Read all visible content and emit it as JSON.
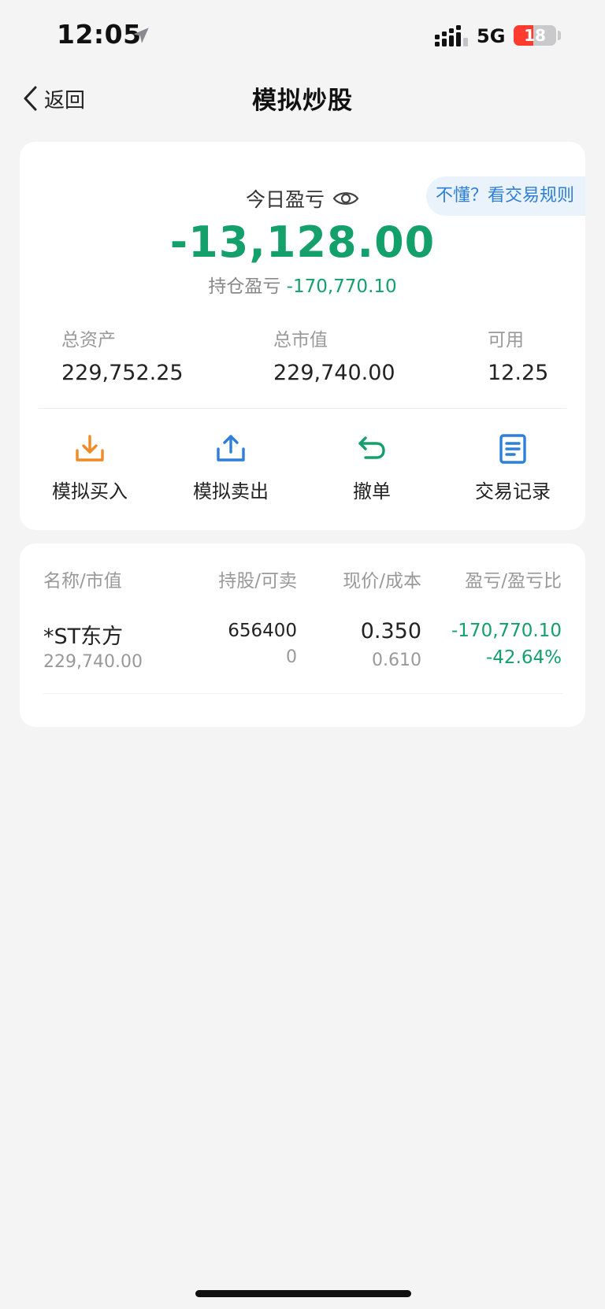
{
  "status_bar": {
    "time": "12:05",
    "network": "5G",
    "battery_level": 18,
    "battery_text": "18",
    "icons": [
      "location-arrow-icon",
      "signal-bars-icon",
      "battery-icon"
    ]
  },
  "nav": {
    "back_label": "返回",
    "title": "模拟炒股",
    "icons": [
      "chevron-left-icon"
    ]
  },
  "summary": {
    "rules_link": "不懂？看交易规则",
    "today_pnl_label": "今日盈亏",
    "today_pnl_value": "-13,128.00",
    "position_pnl_label": "持仓盈亏",
    "position_pnl_value": "-170,770.10",
    "stats": [
      {
        "label": "总资产",
        "value": "229,752.25"
      },
      {
        "label": "总市值",
        "value": "229,740.00"
      },
      {
        "label": "可用",
        "value": "12.25"
      }
    ]
  },
  "actions": [
    {
      "label": "模拟买入",
      "icon": "download-tray-icon",
      "color": "#f08a24"
    },
    {
      "label": "模拟卖出",
      "icon": "upload-tray-icon",
      "color": "#2e7fd9"
    },
    {
      "label": "撤单",
      "icon": "undo-arrow-icon",
      "color": "#14a06a"
    },
    {
      "label": "交易记录",
      "icon": "document-list-icon",
      "color": "#2e7fd9"
    }
  ],
  "holdings": {
    "columns": [
      "名称/市值",
      "持股/可卖",
      "现价/成本",
      "盈亏/盈亏比"
    ],
    "rows": [
      {
        "name": "*ST东方",
        "market_value": "229,740.00",
        "shares": "656400",
        "sellable": "0",
        "price": "0.350",
        "cost": "0.610",
        "pnl": "-170,770.10",
        "pnl_ratio": "-42.64%"
      }
    ]
  },
  "colors": {
    "loss_green": "#14a06a",
    "link_blue": "#2e7fd9",
    "buy_orange": "#f08a24",
    "background": "#f4f4f5"
  }
}
